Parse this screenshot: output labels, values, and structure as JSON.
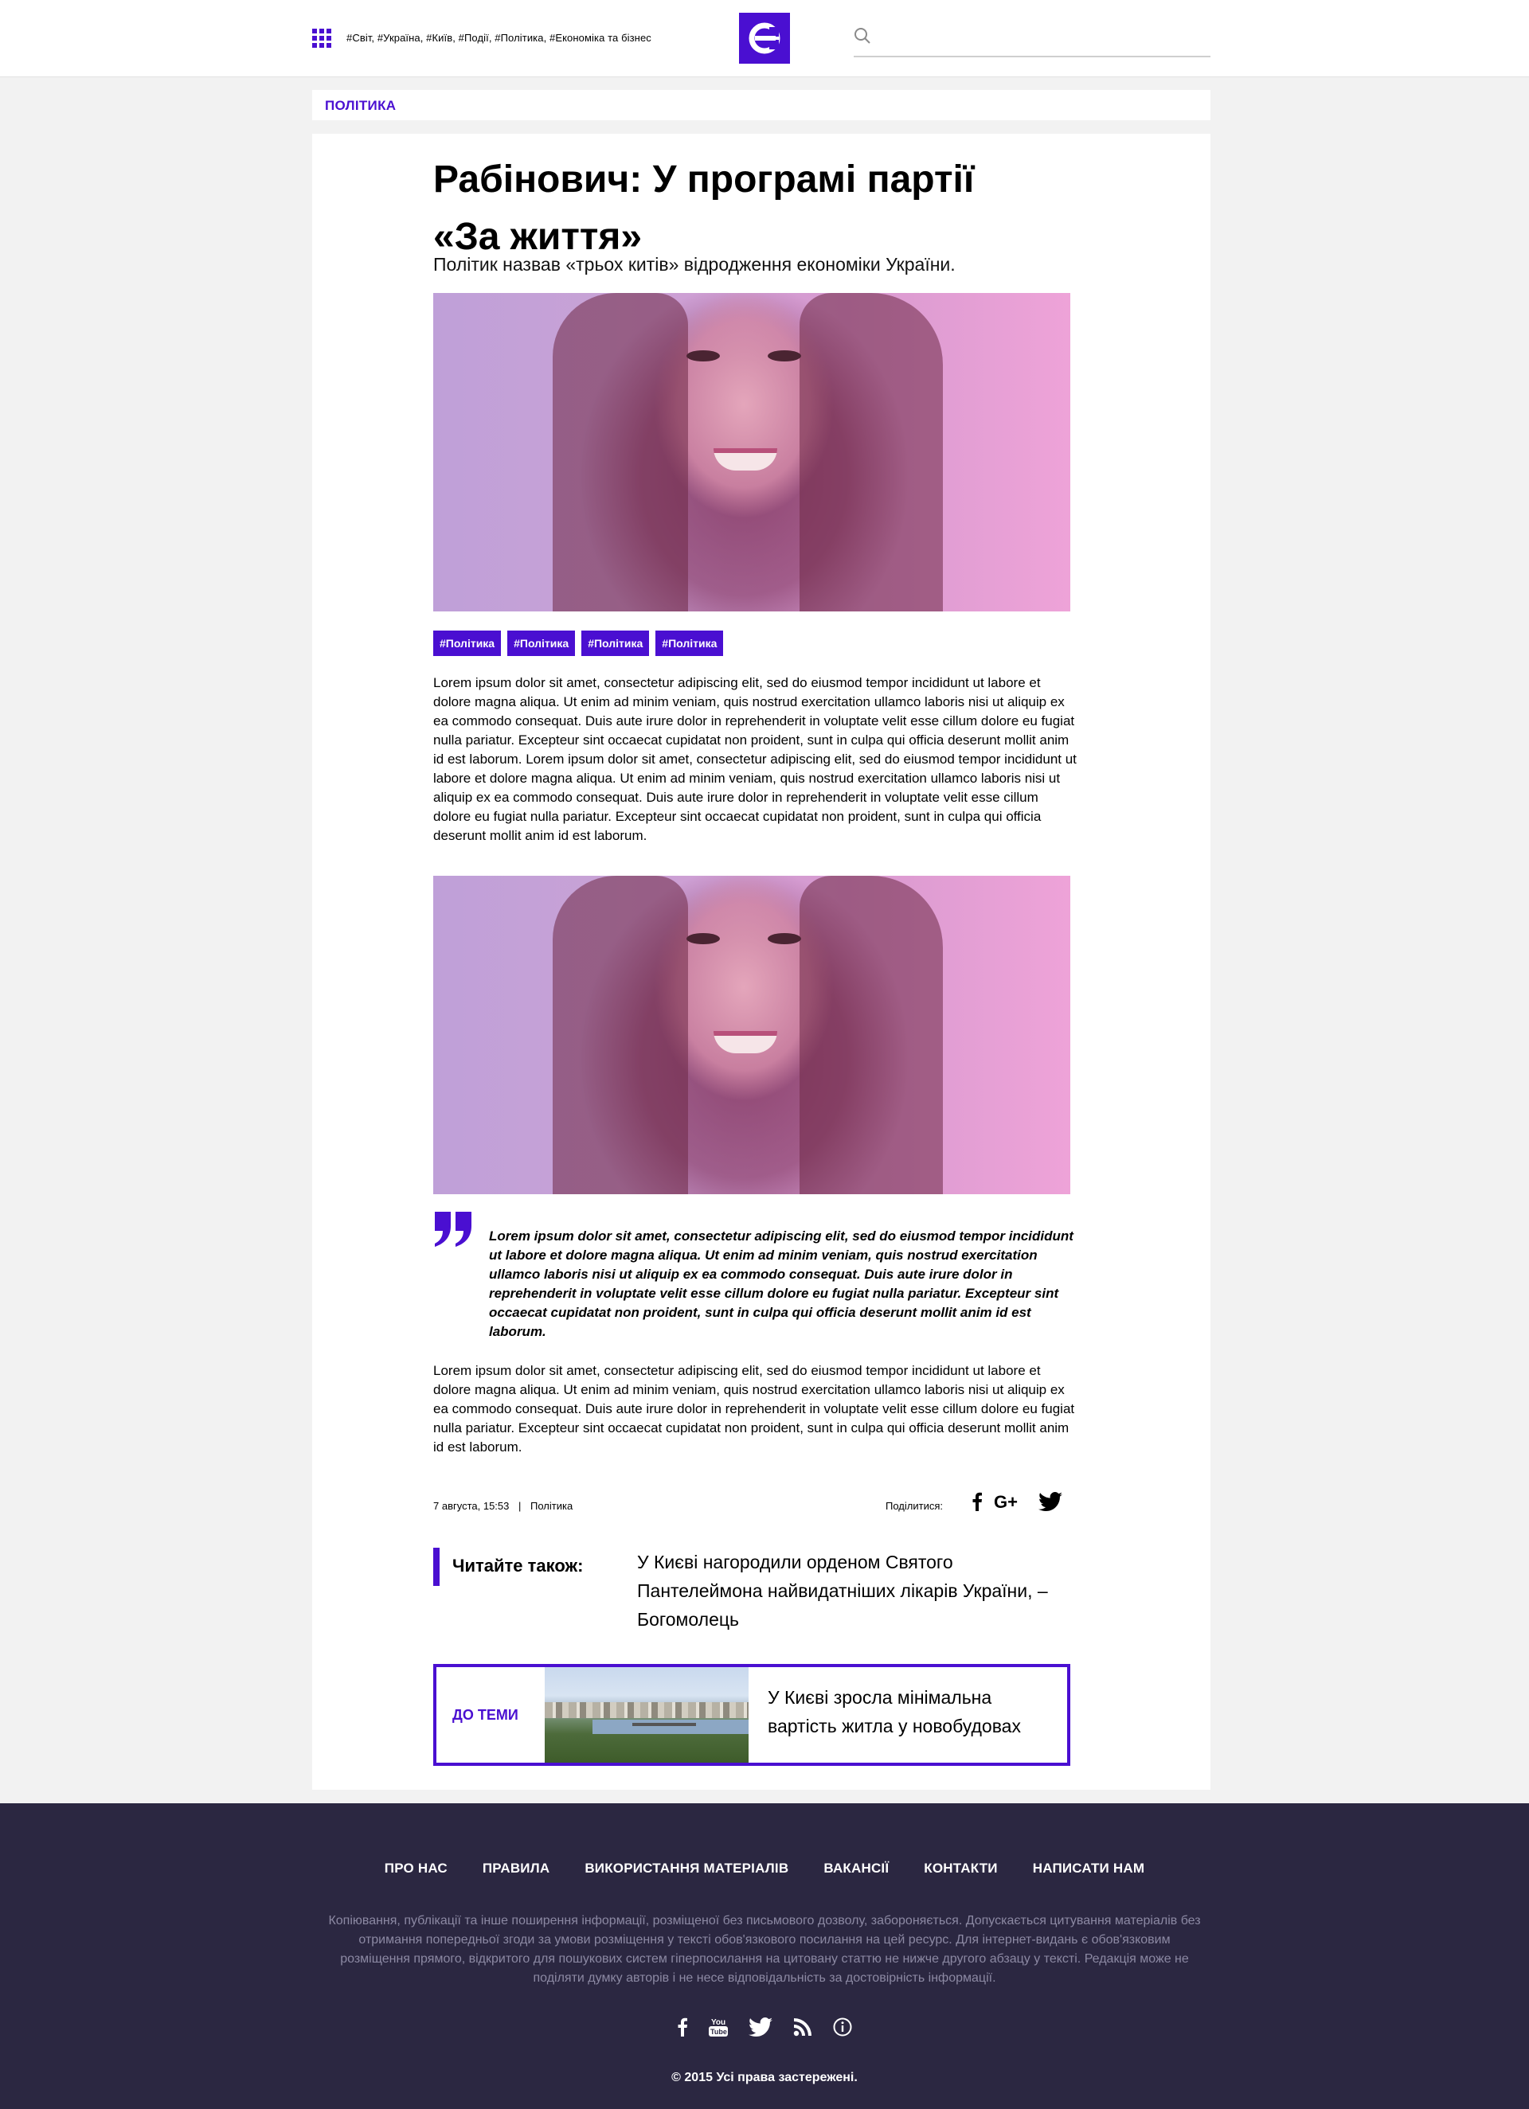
{
  "header": {
    "tags_text": "#Світ, #Україна, #Київ, #Події, #Політика, #Економіка та бізнес",
    "search": {
      "placeholder": "",
      "value": ""
    }
  },
  "section": {
    "label": "ПОЛІТИКА"
  },
  "article": {
    "title": "Рабінович: У програмі партії «За життя»",
    "subtitle": "Політик назвав «трьох китів» відродження економіки України.",
    "tags": [
      "#Політика",
      "#Політика",
      "#Політика",
      "#Політика"
    ],
    "paragraph_1": "Lorem ipsum dolor sit amet, consectetur adipiscing elit, sed do eiusmod tempor incididunt ut labore et dolore magna aliqua. Ut enim ad minim veniam, quis nostrud exercitation ullamco laboris nisi ut aliquip ex ea commodo consequat. Duis aute irure dolor in reprehenderit in voluptate velit esse cillum dolore eu fugiat nulla pariatur. Excepteur sint occaecat cupidatat non proident, sunt in culpa qui officia deserunt mollit anim id est laborum. Lorem ipsum dolor sit amet, consectetur adipiscing elit, sed do eiusmod tempor incididunt ut labore et dolore magna aliqua. Ut enim ad minim veniam, quis nostrud exercitation ullamco laboris nisi ut aliquip ex ea commodo consequat. Duis aute irure dolor in reprehenderit in voluptate velit esse cillum dolore eu fugiat nulla pariatur. Excepteur sint occaecat cupidatat non proident, sunt in culpa qui officia deserunt mollit anim id est laborum.",
    "quote": "Lorem ipsum dolor sit amet, consectetur adipiscing elit, sed do eiusmod tempor incididunt ut labore et dolore magna aliqua. Ut enim ad minim veniam, quis nostrud exercitation ullamco laboris nisi ut aliquip ex ea commodo consequat. Duis aute irure dolor in reprehenderit in voluptate velit esse cillum dolore eu fugiat nulla pariatur. Excepteur sint occaecat cupidatat non proident, sunt in culpa qui officia deserunt mollit anim id est laborum.",
    "paragraph_2": "Lorem ipsum dolor sit amet, consectetur adipiscing elit, sed do eiusmod tempor incididunt ut labore et dolore magna aliqua. Ut enim ad minim veniam, quis nostrud exercitation ullamco laboris nisi ut aliquip ex ea commodo consequat. Duis aute irure dolor in reprehenderit in voluptate velit esse cillum dolore eu fugiat nulla pariatur. Excepteur sint occaecat cupidatat non proident, sunt in culpa qui officia deserunt mollit anim id est laborum.",
    "date": "7 августа, 15:53",
    "meta_separator": "|",
    "category": "Політика",
    "share_label": "Поділитися:",
    "share_icons": [
      "facebook-icon",
      "google-plus-icon",
      "twitter-icon"
    ]
  },
  "read_also": {
    "label": "Читайте також:",
    "title": "У Києві нагородили орденом Святого Пантелеймона найвидатніших лікарів України, – Богомолець"
  },
  "related": {
    "label": "ДО ТЕМИ",
    "title": "У Києві зросла мінімальна вартість житла у новобудовах"
  },
  "footer": {
    "nav": [
      "ПРО НАС",
      "ПРАВИЛА",
      "ВИКОРИСТАННЯ МАТЕРІАЛІВ",
      "ВАКАНСІЇ",
      "КОНТАКТИ",
      "НАПИСАТИ НАМ"
    ],
    "disclaimer": "Копіювання, публікації та інше поширення інформації, розміщеної без письмового дозволу, забороняється. Допускається цитування матеріалів без отримання попередньої згоди за умови розміщення у тексті обов'язкового посилання на цей ресурс. Для інтернет-видань є обов'язковим розміщення прямого, відкритого для пошукових систем гіперпосилання на цитовану статтю не нижче другого абзацу у тексті. Редакція може не поділяти думку авторів і не несе відповідальність за достовірність інформації.",
    "social_icons": [
      "facebook-icon",
      "youtube-icon",
      "twitter-icon",
      "rss-icon",
      "info-icon"
    ],
    "copyright": "© 2015 Усі права застережені."
  },
  "colors": {
    "accent": "#4a0fd1",
    "footer_bg": "#2b2741",
    "page_bg": "#f2f2f2"
  }
}
